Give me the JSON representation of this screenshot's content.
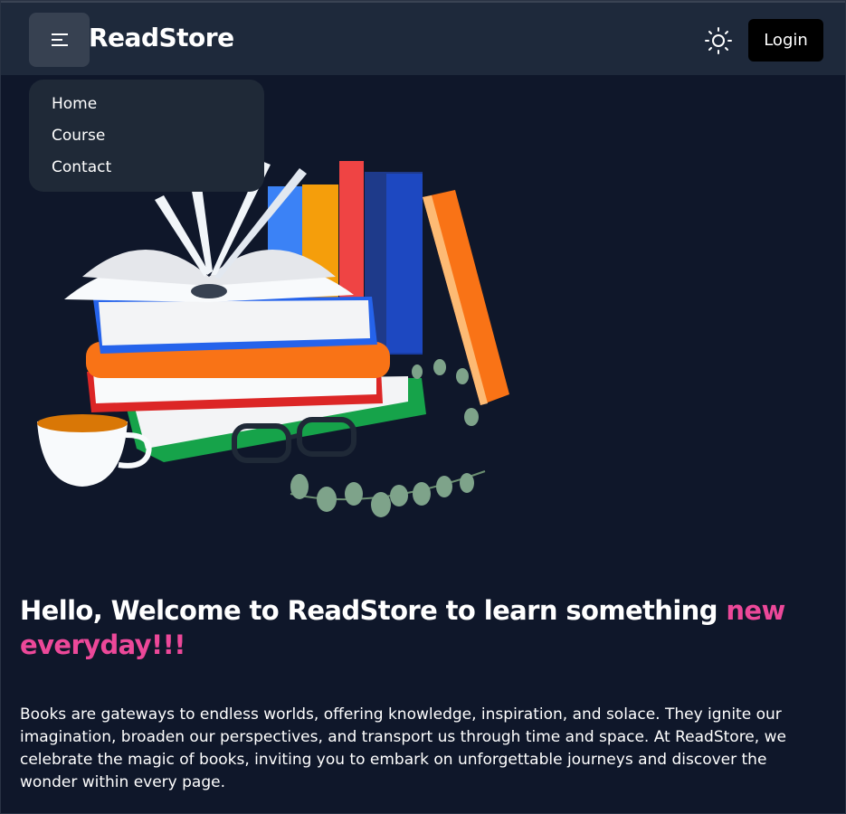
{
  "header": {
    "brand": "ReadStore",
    "login_label": "Login",
    "menu_icon": "hamburger-icon",
    "theme_icon": "sun-icon"
  },
  "menu": {
    "items": [
      {
        "label": "Home"
      },
      {
        "label": "Course"
      },
      {
        "label": "Contact"
      }
    ]
  },
  "hero": {
    "headline": "Hello, Welcome to ReadStore to learn something ",
    "headline_accent": "new everyday!!!",
    "description": "Books are gateways to endless worlds, offering knowledge, inspiration, and solace. They ignite our imagination, broaden our perspectives, and transport us through time and space. At ReadStore, we celebrate the magic of books, inviting you to embark on unforgettable journeys and discover the wonder within every page."
  },
  "colors": {
    "background": "#0f172a",
    "navbar": "#1e293b",
    "accent": "#ec4899"
  }
}
